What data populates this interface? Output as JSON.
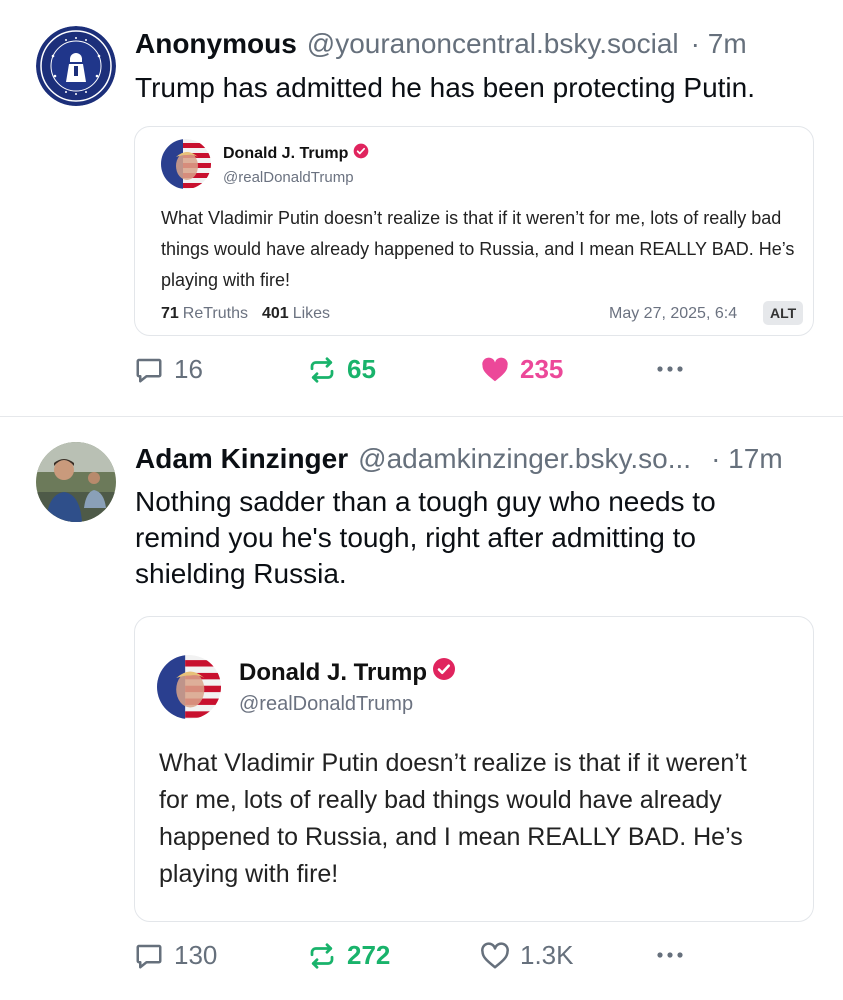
{
  "posts": [
    {
      "author_name": "Anonymous",
      "author_handle": "@youranoncentral.bsky.social",
      "time": "· 7m",
      "text": "Trump has admitted he has been protecting Putin.",
      "embed": {
        "name": "Donald J. Trump",
        "handle": "@realDonaldTrump",
        "text": "What Vladimir Putin doesn’t realize is that if it weren’t for me, lots of really bad things would have already happened to Russia, and I mean REALLY BAD. He’s playing with fire!",
        "retruths_count": "71",
        "retruths_label": "ReTruths",
        "likes_count": "401",
        "likes_label": "Likes",
        "date": "May 27, 2025, 6:4",
        "alt_label": "ALT"
      },
      "replies": "16",
      "reposts": "65",
      "likes": "235",
      "liked": true
    },
    {
      "author_name": "Adam Kinzinger",
      "author_handle": "@adamkinzinger.bsky.so...",
      "time": "· 17m",
      "text": "Nothing sadder than a tough guy who needs to remind you he's tough, right after admitting to shielding Russia.",
      "embed": {
        "name": "Donald J. Trump",
        "handle": "@realDonaldTrump",
        "text": "What Vladimir Putin doesn’t realize is that if it weren’t for me, lots of really bad things would have already happened to Russia, and I mean REALLY BAD. He’s playing with fire!"
      },
      "replies": "130",
      "reposts": "272",
      "likes": "1.3K",
      "liked": false
    }
  ],
  "icons": {
    "reply": "speech-bubble-icon",
    "repost": "repost-arrows-icon",
    "like": "heart-icon",
    "more": "ellipsis-icon",
    "verified": "verified-badge-icon"
  },
  "colors": {
    "repost_green": "#19b36b",
    "like_pink": "#ec4899",
    "muted": "#66707c",
    "verified_red": "#e0245e"
  }
}
